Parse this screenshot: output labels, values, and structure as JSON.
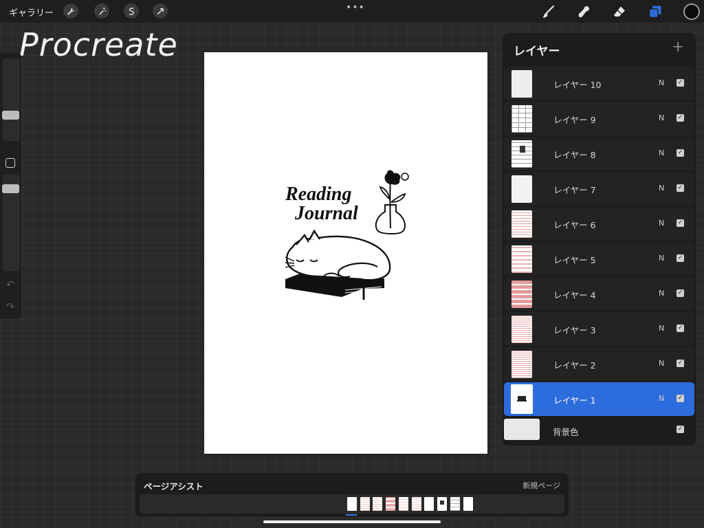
{
  "topbar": {
    "gallery_label": "ギャラリー",
    "more_label": "•••",
    "left_tools": [
      "wrench-icon",
      "magic-wand-icon",
      "selection-icon",
      "transform-arrow-icon"
    ],
    "right_tools": [
      "brush-icon",
      "smudge-icon",
      "eraser-icon",
      "layers-icon",
      "color-icon"
    ],
    "accent_color": "#2d6cdc"
  },
  "watermark": "Procreate",
  "canvas": {
    "title_line1": "Reading",
    "title_line2": "Journal"
  },
  "layers": {
    "title": "レイヤー",
    "add_label": "+",
    "items": [
      {
        "name": "レイヤー 10",
        "mode": "N",
        "visible": true,
        "selected": false,
        "thumb": "blank"
      },
      {
        "name": "レイヤー 9",
        "mode": "N",
        "visible": true,
        "selected": false,
        "thumb": "grid"
      },
      {
        "name": "レイヤー 8",
        "mode": "N",
        "visible": true,
        "selected": false,
        "thumb": "grid-dark"
      },
      {
        "name": "レイヤー 7",
        "mode": "N",
        "visible": true,
        "selected": false,
        "thumb": "blank"
      },
      {
        "name": "レイヤー 6",
        "mode": "N",
        "visible": true,
        "selected": false,
        "thumb": "pink-lines"
      },
      {
        "name": "レイヤー 5",
        "mode": "N",
        "visible": true,
        "selected": false,
        "thumb": "pink-text"
      },
      {
        "name": "レイヤー 4",
        "mode": "N",
        "visible": true,
        "selected": false,
        "thumb": "pink-grid"
      },
      {
        "name": "レイヤー 3",
        "mode": "N",
        "visible": true,
        "selected": false,
        "thumb": "pink-lines"
      },
      {
        "name": "レイヤー 2",
        "mode": "N",
        "visible": true,
        "selected": false,
        "thumb": "pink-lines"
      },
      {
        "name": "レイヤー 1",
        "mode": "N",
        "visible": true,
        "selected": true,
        "thumb": "cat"
      }
    ],
    "background": {
      "name": "背景色",
      "visible": true
    }
  },
  "page_assist": {
    "title": "ページアシスト",
    "new_page_label": "新規ページ",
    "thumb_count": 10,
    "active_index": 0
  }
}
